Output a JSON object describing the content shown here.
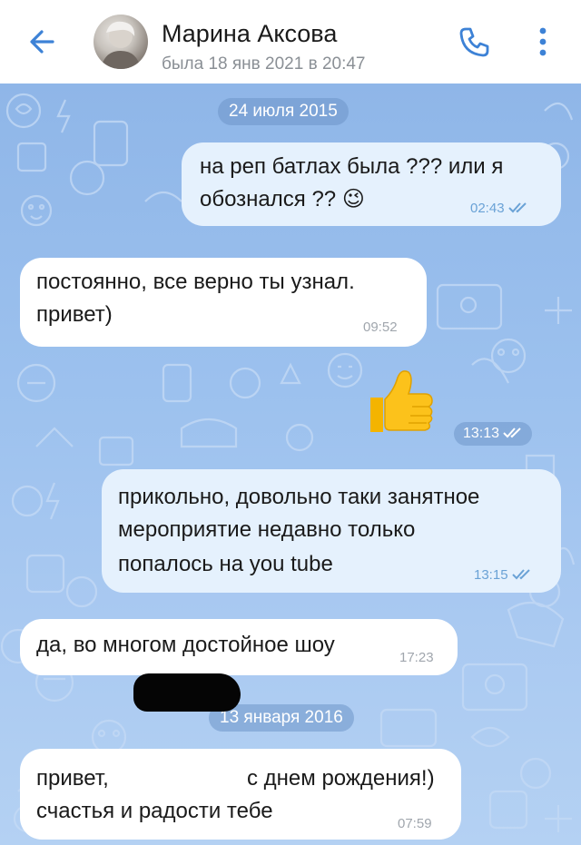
{
  "header": {
    "contact_name": "Марина Аксова",
    "last_seen": "была 18 янв 2021 в 20:47",
    "back_icon": "arrow-left-icon",
    "call_icon": "phone-icon",
    "menu_icon": "more-vertical-icon"
  },
  "colors": {
    "accent": "#3d82d6",
    "outgoing_bubble": "#e5f1fd",
    "incoming_bubble": "#ffffff",
    "chat_background": "#9cc1ee"
  },
  "dates": {
    "d1": "24 июля 2015",
    "d2": "13 января 2016"
  },
  "messages": {
    "m1": {
      "line1": "на реп батлах была ??? или я",
      "line2": "обознался ??",
      "emoji": "😉",
      "time": "02:43",
      "direction": "out",
      "read": true
    },
    "m2": {
      "line1": "постоянно, все верно ты узнал.",
      "line2": "привет)",
      "time": "09:52",
      "direction": "in"
    },
    "m3": {
      "sticker": "thumbs-up-icon",
      "time": "13:13",
      "direction": "out",
      "read": true
    },
    "m4": {
      "line1": "прикольно, довольно таки занятное",
      "line2": "мероприятие недавно только",
      "line3": "попалось на you tube",
      "time": "13:15",
      "direction": "out",
      "read": true
    },
    "m5": {
      "line1": "да, во многом достойное шоу",
      "time": "17:23",
      "direction": "in"
    },
    "m6": {
      "line1a": "привет,",
      "line1b": "с днем рождения!)",
      "line2": "счастья и радости тебе",
      "time": "07:59",
      "direction": "in"
    }
  }
}
